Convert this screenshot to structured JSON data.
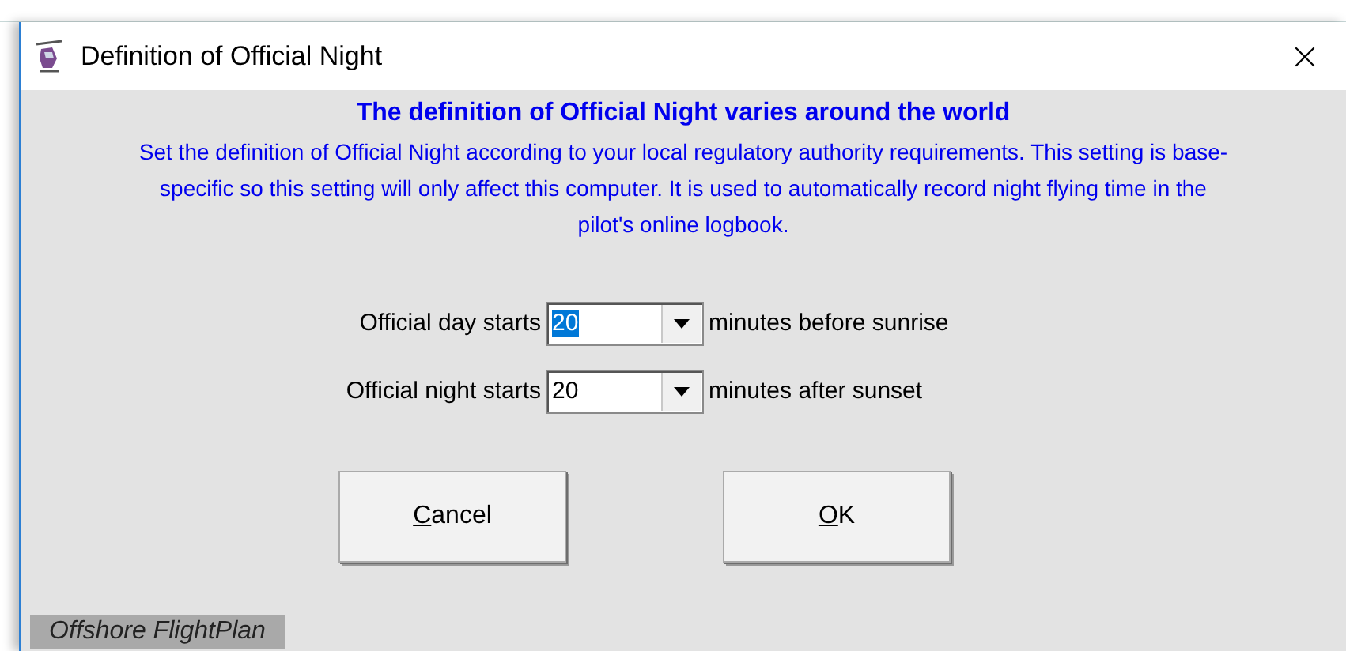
{
  "window": {
    "title": "Definition of Official Night"
  },
  "heading": "The definition of Official Night varies around the world",
  "description": "Set the definition of Official Night according to your local regulatory authority requirements. This setting is base-specific so this setting will only affect this computer. It is used to automatically record night flying time in the pilot's online logbook.",
  "settings": [
    {
      "label": "Official day starts",
      "value": "20",
      "selected": true,
      "suffix": "minutes before sunrise"
    },
    {
      "label": "Official night starts",
      "value": "20",
      "selected": false,
      "suffix": "minutes after sunset"
    }
  ],
  "buttons": [
    {
      "label": "Cancel",
      "underline_first": true
    },
    {
      "label": "OK",
      "underline_first": true
    }
  ],
  "footer": "Offshore FlightPlan"
}
